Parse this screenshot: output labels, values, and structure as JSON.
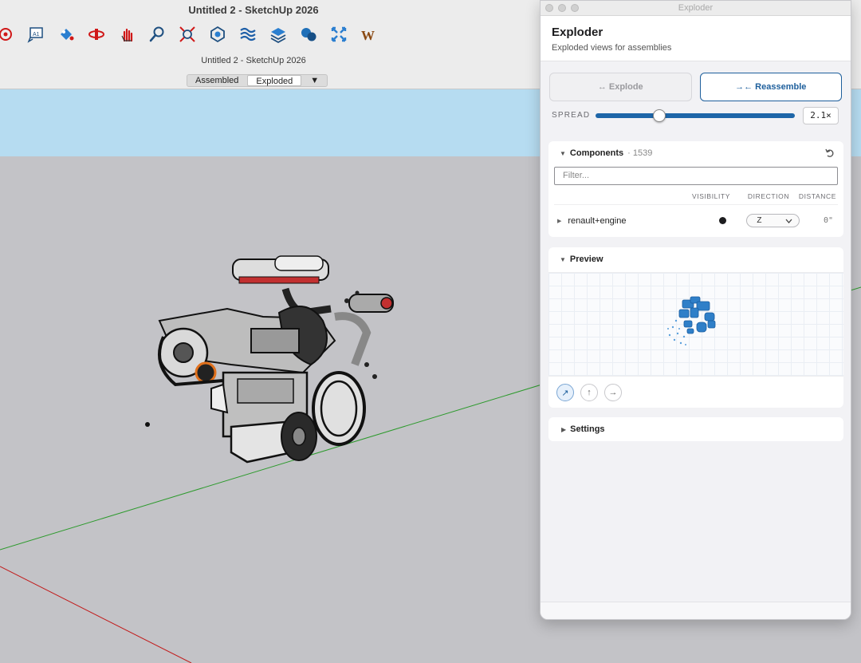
{
  "app": {
    "window_title": "Untitled 2 - SketchUp 2026",
    "document_title": "Untitled 2 - SketchUp 2026",
    "toolbar_icons": [
      "target-icon",
      "text-tool-icon",
      "paint-bucket-icon",
      "orbit-icon",
      "pan-icon",
      "zoom-icon",
      "zoom-extents-icon",
      "component-icon",
      "layers-icon",
      "stack-icon",
      "chat-icon",
      "fullscreen-icon",
      "warehouse-icon"
    ],
    "scenes": [
      {
        "label": "Assembled",
        "active": false
      },
      {
        "label": "Exploded",
        "active": true
      }
    ],
    "scene_menu": "▼",
    "colors": {
      "sky": "#b6dcf1",
      "ground": "#c3c3c7",
      "x_axis": "#c21b1b",
      "y_axis": "#2d9a2d"
    }
  },
  "panel": {
    "window_title": "Exploder",
    "title": "Exploder",
    "subtitle": "Exploded views for assemblies",
    "explode_button": "↔ Explode",
    "reassemble_button": "→← Reassemble",
    "spread_label": "SPREAD",
    "spread_value": "2.1×",
    "spread_fraction": 0.32,
    "components": {
      "title": "Components",
      "count": "· 1539",
      "filter_placeholder": "Filter...",
      "columns": [
        "VISIBILITY",
        "DIRECTION",
        "DISTANCE"
      ],
      "rows": [
        {
          "name": "renault+engine",
          "visible": true,
          "direction": "Z",
          "distance": "0\""
        }
      ]
    },
    "preview": {
      "title": "Preview"
    },
    "view_buttons": [
      "↗",
      "↑",
      "→"
    ],
    "settings": {
      "title": "Settings"
    },
    "accent": "#1e5f9c"
  }
}
